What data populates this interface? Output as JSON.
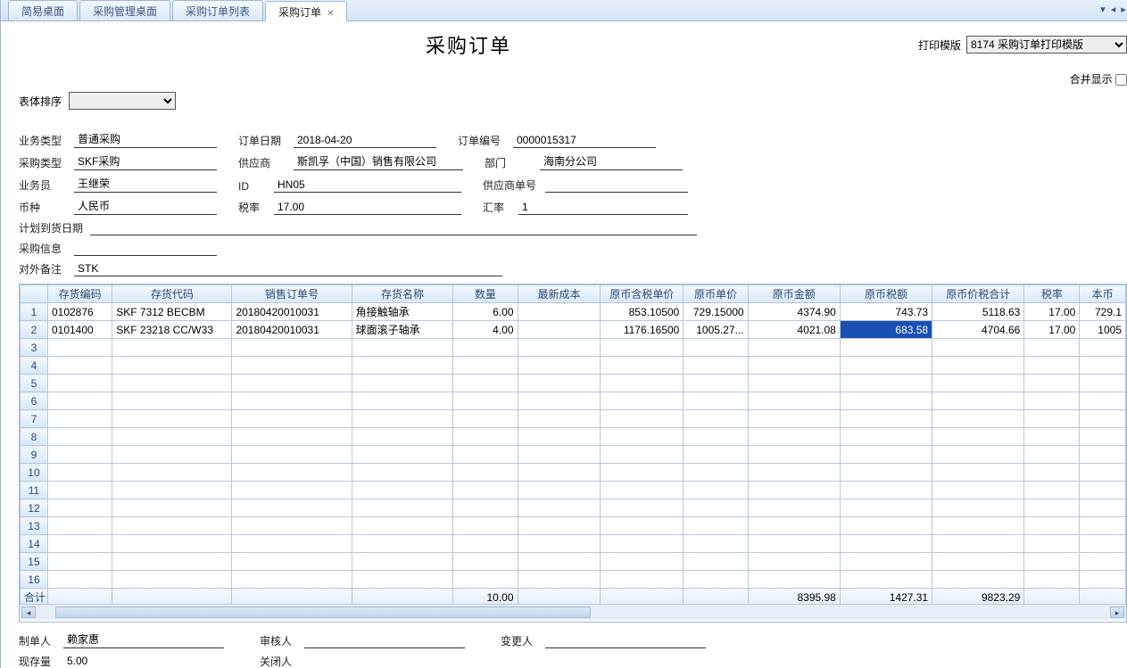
{
  "tabs": [
    {
      "label": "简易桌面",
      "active": false
    },
    {
      "label": "采购管理桌面",
      "active": false
    },
    {
      "label": "采购订单列表",
      "active": false
    },
    {
      "label": "采购订单",
      "active": true
    }
  ],
  "title": "采购订单",
  "print_template_label": "打印模版",
  "print_template_value": "8174 采购订单打印模版",
  "merge_label": "合并显示",
  "sort_label": "表体排序",
  "fields": {
    "business_type": {
      "label": "业务类型",
      "value": "普通采购"
    },
    "order_date": {
      "label": "订单日期",
      "value": "2018-04-20"
    },
    "order_no": {
      "label": "订单编号",
      "value": "0000015317"
    },
    "purchase_type": {
      "label": "采购类型",
      "value": "SKF采购"
    },
    "supplier": {
      "label": "供应商",
      "value": "斯凯孚（中国）销售有限公司"
    },
    "dept": {
      "label": "部门",
      "value": "海南分公司"
    },
    "clerk": {
      "label": "业务员",
      "value": "王继荣"
    },
    "id": {
      "label": "ID",
      "value": "HN05"
    },
    "supplier_no": {
      "label": "供应商单号",
      "value": ""
    },
    "currency": {
      "label": "币种",
      "value": "人民币"
    },
    "tax_rate": {
      "label": "税率",
      "value": "17.00"
    },
    "exchange": {
      "label": "汇率",
      "value": "1"
    },
    "plan_date": {
      "label": "计划到货日期",
      "value": ""
    },
    "purchase_info": {
      "label": "采购信息",
      "value": ""
    },
    "remark": {
      "label": "对外备注",
      "value": "STK"
    }
  },
  "columns": [
    "存货编码",
    "存货代码",
    "销售订单号",
    "存货名称",
    "数量",
    "最新成本",
    "原币含税单价",
    "原币单价",
    "原币金额",
    "原币税额",
    "原币价税合计",
    "税率",
    "本币"
  ],
  "rows": [
    {
      "n": "1",
      "code": "0102876",
      "sku": "SKF 7312 BECBM",
      "so": "20180420010031",
      "name": "角接触轴承",
      "qty": "6.00",
      "cost": "",
      "taxprice": "853.10500",
      "price": "729.15000",
      "amt": "4374.90",
      "tax": "743.73",
      "total": "5118.63",
      "rate": "17.00",
      "local": "729.1"
    },
    {
      "n": "2",
      "code": "0101400",
      "sku": "SKF 23218 CC/W33",
      "so": "20180420010031",
      "name": "球面滚子轴承",
      "qty": "4.00",
      "cost": "",
      "taxprice": "1176.16500",
      "price": "1005.27...",
      "amt": "4021.08",
      "tax": "683.58",
      "total": "4704.66",
      "rate": "17.00",
      "local": "1005"
    }
  ],
  "totals": {
    "label": "合计",
    "qty": "10.00",
    "amt": "8395.98",
    "tax": "1427.31",
    "total": "9823.29"
  },
  "footer": {
    "maker": {
      "label": "制单人",
      "value": "赖家惠"
    },
    "auditor": {
      "label": "审核人",
      "value": ""
    },
    "changer": {
      "label": "变更人",
      "value": ""
    },
    "stock": {
      "label": "现存量",
      "value": "5.00"
    },
    "closer": {
      "label": "关闭人",
      "value": ""
    }
  }
}
